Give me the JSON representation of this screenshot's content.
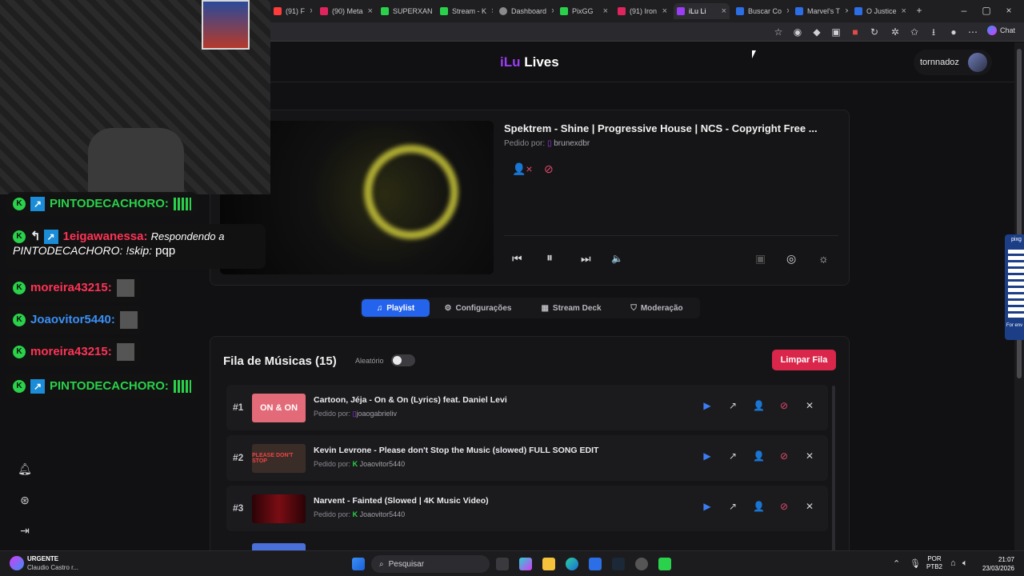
{
  "browser": {
    "tabs": [
      {
        "label": "(91) F",
        "color": "#ff3b3b"
      },
      {
        "label": "(90) Meta",
        "color": "#e0245e"
      },
      {
        "label": "SUPERXAN",
        "color": "#2ad14a"
      },
      {
        "label": "Stream - K",
        "color": "#2ad14a"
      },
      {
        "label": "Dashboard",
        "color": "#8a8a8a"
      },
      {
        "label": "PixGG",
        "color": "#2ad14a"
      },
      {
        "label": "(91) Iron",
        "color": "#e0245e"
      },
      {
        "label": "iLu Li",
        "color": "#9b3df5"
      },
      {
        "label": "Buscar Co",
        "color": "#2b6ee6"
      },
      {
        "label": "Marvel's T",
        "color": "#2b6ee6"
      },
      {
        "label": "O Justice",
        "color": "#2b6ee6"
      }
    ],
    "chat_label": "Chat"
  },
  "app": {
    "logo_brand": "iLu",
    "logo_rest": " Lives",
    "username": "tornnadoz"
  },
  "player": {
    "title": "Spektrem - Shine | Progressive House | NCS - Copyright Free ...",
    "requested_by_label": "Pedido por:",
    "requested_by_user": "brunexdbr"
  },
  "tabs": [
    {
      "label": "Playlist",
      "icon": "♫"
    },
    {
      "label": "Configurações",
      "icon": "⚙"
    },
    {
      "label": "Stream Deck",
      "icon": "▦"
    },
    {
      "label": "Moderação",
      "icon": "⛉"
    }
  ],
  "queue": {
    "title": "Fila de Músicas (15)",
    "shuffle_label": "Aleatório",
    "clear_label": "Limpar Fila",
    "items": [
      {
        "num": "#1",
        "title": "Cartoon, Jéja - On & On (Lyrics) feat. Daniel Levi",
        "req_label": "Pedido por:",
        "user": "joaogabrieliv",
        "thumb_text": "ON & ON",
        "thumb_color": "#e36a78"
      },
      {
        "num": "#2",
        "title": "Kevin Levrone - Please don't Stop the Music (slowed) FULL SONG EDIT",
        "req_label": "Pedido por:",
        "user": "Joaovitor5440",
        "thumb_text": "PLEASE DON'T STOP",
        "thumb_color": "#3a2d28"
      },
      {
        "num": "#3",
        "title": "Narvent - Fainted (Slowed | 4K Music Video)",
        "req_label": "Pedido por:",
        "user": "Joaovitor5440",
        "thumb_text": "",
        "thumb_color": "#7a0d14"
      }
    ]
  },
  "chat": [
    {
      "user": "PINTODECACHORO:",
      "color": "#2ad14a",
      "text": ""
    },
    {
      "user": "1eigawanessa:",
      "color": "#ff3355",
      "text": "Respondendo a",
      "line2": "PINTODECACHORO: !skip:",
      "line2b": "pqp"
    },
    {
      "user": "moreira43215:",
      "color": "#ff3355",
      "text": ""
    },
    {
      "user": "Joaovitor5440:",
      "color": "#3b8ff5",
      "text": ""
    },
    {
      "user": "moreira43215:",
      "color": "#ff3355",
      "text": ""
    },
    {
      "user": "PINTODECACHORO:",
      "color": "#2ad14a",
      "text": ""
    }
  ],
  "qr": {
    "label": "pixg",
    "sub": "For env"
  },
  "taskbar": {
    "notif_title": "URGENTE",
    "notif_sub": "Claudio Castro r...",
    "search_placeholder": "Pesquisar",
    "lang": "POR",
    "layout": "PTB2",
    "time": "21:07",
    "date": "23/03/2026"
  }
}
